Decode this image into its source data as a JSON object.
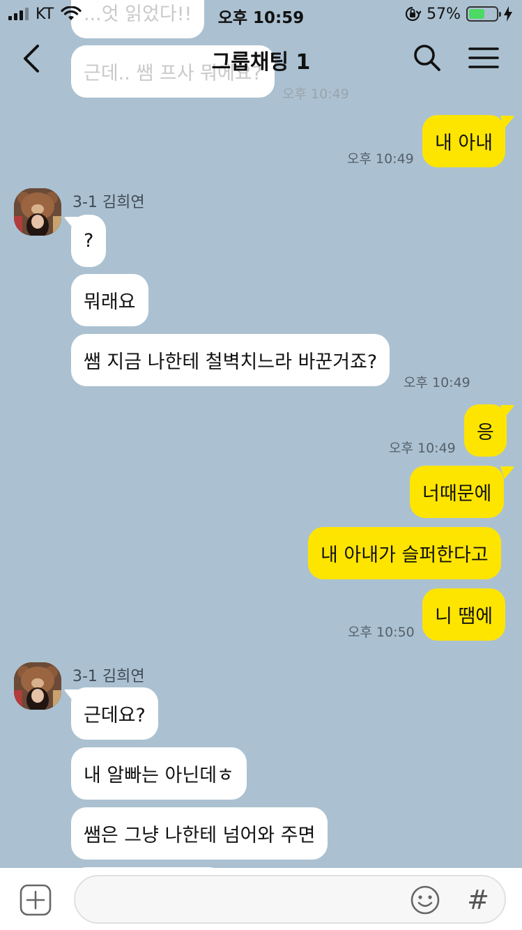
{
  "status_bar": {
    "carrier": "KT",
    "time": "오후 10:59",
    "battery_percent": "57%",
    "battery_level": 0.57
  },
  "header": {
    "title": "그룹채팅 1",
    "back_icon": "chevron-left-icon",
    "search_icon": "search-icon",
    "menu_icon": "hamburger-menu-icon"
  },
  "messages": [
    {
      "type": "in",
      "text": "...엇 읽었다!!"
    },
    {
      "type": "in",
      "text": "근데.. 쌤 프사 뭐에요?"
    },
    {
      "type": "time",
      "text": "오후 10:49"
    },
    {
      "type": "out",
      "text": "내 아내"
    },
    {
      "type": "time",
      "text": "오후 10:49"
    },
    {
      "type": "sender",
      "text": "3-1 김희연"
    },
    {
      "type": "in",
      "text": "?"
    },
    {
      "type": "in",
      "text": "뭐래요"
    },
    {
      "type": "in",
      "text": "쌤 지금 나한테 철벽치느라 바꾼거죠?"
    },
    {
      "type": "time",
      "text": "오후 10:49"
    },
    {
      "type": "out",
      "text": "응"
    },
    {
      "type": "time",
      "text": "오후 10:49"
    },
    {
      "type": "out",
      "text": "너때문에"
    },
    {
      "type": "out",
      "text": "내 아내가 슬퍼한다고"
    },
    {
      "type": "out",
      "text": "니 땜에"
    },
    {
      "type": "time",
      "text": "오후 10:50"
    },
    {
      "type": "sender",
      "text": "3-1 김희연"
    },
    {
      "type": "in",
      "text": "근데요?"
    },
    {
      "type": "in",
      "text": "내 알빠는 아닌데ㅎ"
    },
    {
      "type": "in",
      "text": "쌤은 그냥 나한테 넘어와 주면"
    }
  ],
  "input_bar": {
    "value": "",
    "placeholder": "",
    "plus_icon": "plus-square-icon",
    "emoji_icon": "emoji-smile-icon",
    "hash_label": "#"
  },
  "colors": {
    "background": "#abc1d1",
    "outgoing_bubble": "#fee500",
    "incoming_bubble": "#ffffff",
    "battery_fill": "#4cd964"
  }
}
